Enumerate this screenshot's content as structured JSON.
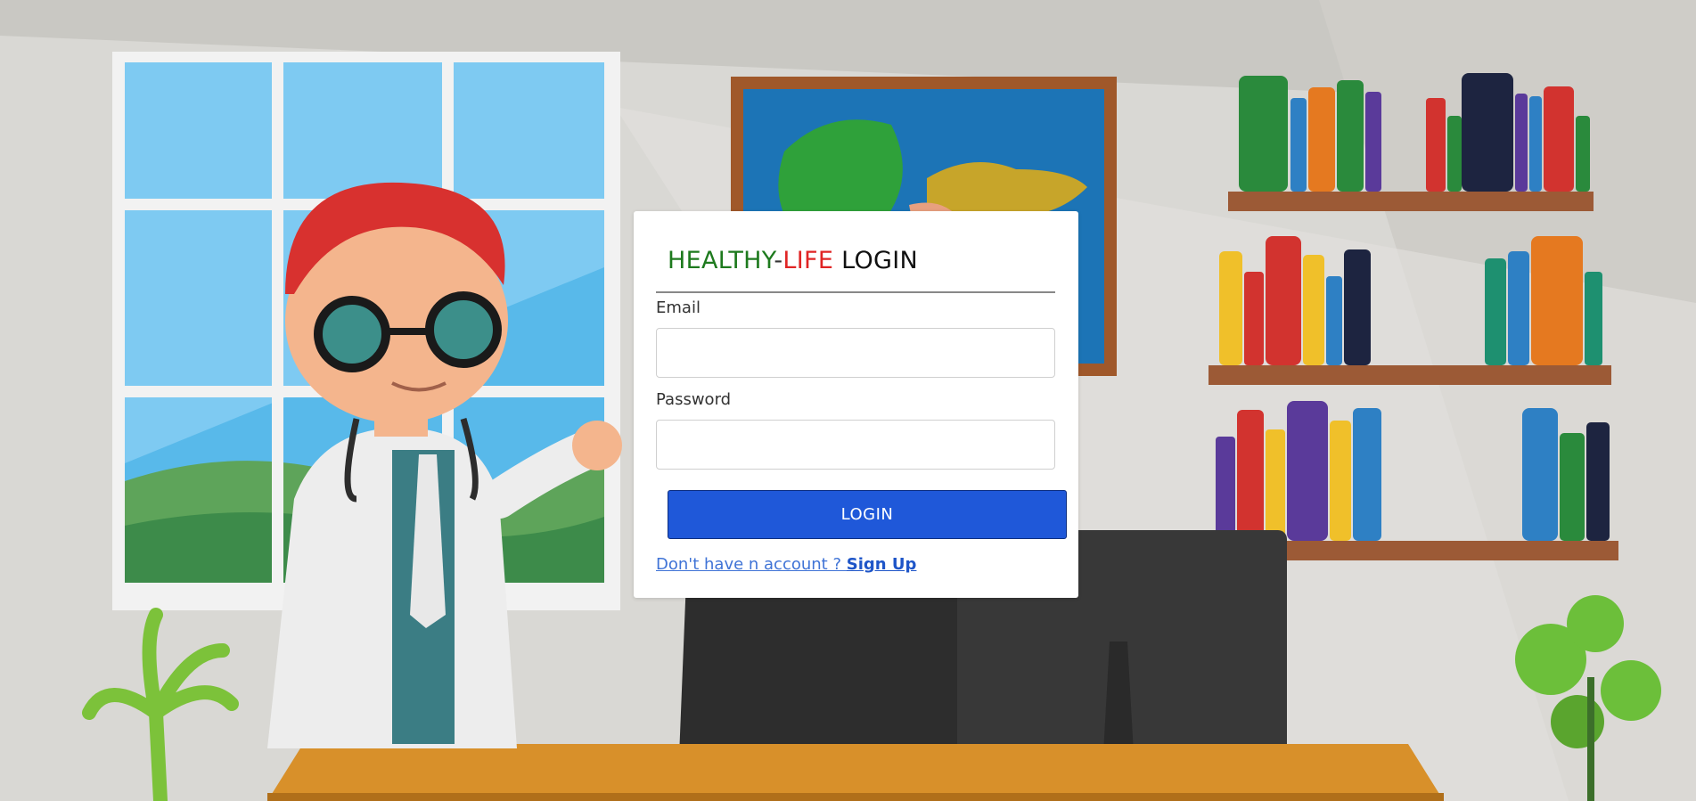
{
  "app": {
    "title_part1": "HEALTHY",
    "title_dash": "-",
    "title_part2": "LIFE",
    "title_part3": " LOGIN"
  },
  "form": {
    "email_label": "Email",
    "email_value": "",
    "password_label": "Password",
    "password_value": "",
    "submit_label": "LOGIN",
    "signup_prompt": "Don't have n account ? ",
    "signup_link": "Sign Up"
  },
  "colors": {
    "title_green": "#1e7a1e",
    "title_red": "#e02525",
    "button_blue": "#1f58d9",
    "link_blue": "#1e55c8"
  },
  "illustration": {
    "description_icon": "doctor-office-illustration"
  }
}
